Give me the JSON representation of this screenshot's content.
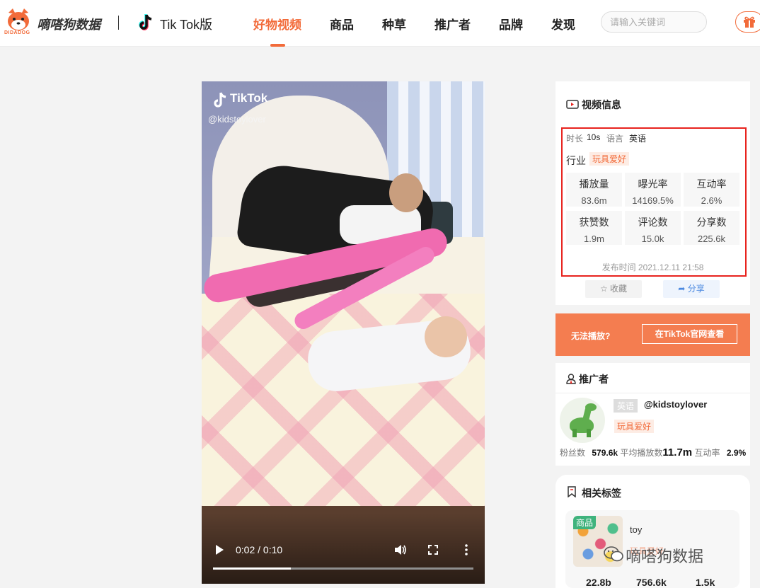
{
  "header": {
    "brand": "嘀嗒狗数据",
    "logo_sub": "DIDADOG",
    "platform": "Tik Tok版",
    "nav": [
      "好物视频",
      "商品",
      "种草",
      "推广者",
      "品牌",
      "发现"
    ],
    "active_nav": "好物视频",
    "search_placeholder": "请输入关键词"
  },
  "video": {
    "tiktok_label": "TikTok",
    "handle": "@kidstoylover",
    "time": "0:02 / 0:10",
    "progress_fraction": 0.3
  },
  "video_info": {
    "title": "视频信息",
    "duration_label": "时长",
    "duration": "10s",
    "language_label": "语言",
    "language": "英语",
    "industry_label": "行业",
    "industry": "玩具爱好",
    "stats": [
      {
        "label": "播放量",
        "value": "83.6m"
      },
      {
        "label": "曝光率",
        "value": "14169.5%"
      },
      {
        "label": "互动率",
        "value": "2.6%"
      },
      {
        "label": "获赞数",
        "value": "1.9m"
      },
      {
        "label": "评论数",
        "value": "15.0k"
      },
      {
        "label": "分享数",
        "value": "225.6k"
      }
    ],
    "publish_time": "发布时间 2021.12.11 21:58",
    "favorite": "收藏",
    "share": "分享"
  },
  "banner": {
    "text": "无法播放?",
    "button": "在TikTok官网查看"
  },
  "promoter": {
    "title": "推广者",
    "language": "英语",
    "handle": "@kidstoylover",
    "category": "玩具爱好",
    "fans_label": "粉丝数",
    "fans": "579.6k",
    "avg_plays_label": "平均播放数",
    "avg_plays": "11.7m",
    "engagement_label": "互动率",
    "engagement": "2.9%"
  },
  "related_tags": {
    "title": "相关标签",
    "badge": "商品",
    "name": "toy",
    "sub": "玩具爱好",
    "numbers": [
      "22.8b",
      "756.6k",
      "1.5k"
    ]
  },
  "watermark": "嘀嗒狗数据",
  "colors": {
    "accent": "#f26b3a",
    "highlight_border": "#e8231e",
    "banner": "#f47d50"
  }
}
